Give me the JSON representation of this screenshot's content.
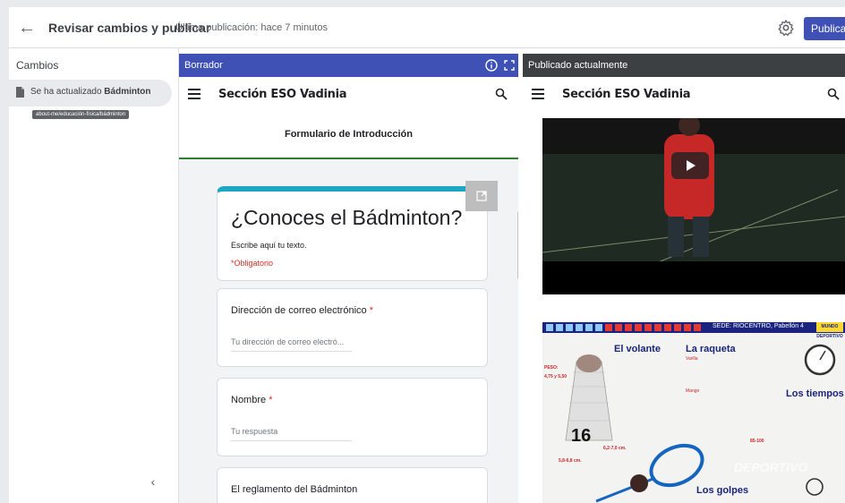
{
  "topbar": {
    "title": "Revisar cambios y publicar",
    "last_published": "Última publicación: hace 7 minutos",
    "publish_label": "Publicar"
  },
  "sidebar": {
    "title": "Cambios",
    "change_prefix": "Se ha actualizado",
    "change_page": "Bádminton",
    "tooltip_path": "about-me/educación-física/bádminton"
  },
  "draft": {
    "header": "Borrador",
    "site_name": "Sección ESO Vadinia",
    "form_title": "Formulario de Introducción",
    "quiz_title": "¿Conoces el Bádminton?",
    "quiz_description": "Escribe aquí tu texto.",
    "required_note": "*Obligatorio",
    "questions": [
      {
        "label": "Dirección de correo electrónico",
        "required": "*",
        "placeholder": "Tu dirección de correo electró..."
      },
      {
        "label": "Nombre",
        "required": "*",
        "placeholder": "Tu respuesta"
      },
      {
        "label": "El reglamento del Bádminton",
        "required": "",
        "placeholder": ""
      }
    ]
  },
  "published": {
    "header": "Publicado actualmente",
    "site_name": "Sección ESO Vadinia",
    "infographic": {
      "sede": "SEDE: RIOCENTRO, Pabellón 4",
      "brand": "MUNDO DEPORTIVO",
      "volante_title": "El volante",
      "raqueta_title": "La raqueta",
      "varilla": "Varilla",
      "mango": "Mango",
      "tiempos_title": "Los tiempos",
      "golpes_title": "Los golpes",
      "peso_label": "PESO:",
      "peso_volante": "4,75 y 5,50",
      "peso_raqueta": "85-100",
      "plumas": "16",
      "longitud": "6,2-7,0 cm.",
      "diametro": "5,8-6,8 cm.",
      "watermark": "DEPORTIVO"
    }
  },
  "icons": {
    "back": "arrow-left-icon",
    "gear": "gear-icon",
    "doc": "document-icon",
    "info": "info-icon",
    "fullscreen": "fullscreen-icon",
    "menu": "hamburger-menu-icon",
    "search": "search-icon",
    "edit": "open-external-icon",
    "play": "play-icon",
    "collapse": "chevron-left-icon"
  },
  "colors": {
    "accent": "#3f51b5",
    "published_header": "#3c4043",
    "form_bar": "#1ea7c5",
    "required": "#d93025",
    "divider": "#2e7d32"
  }
}
